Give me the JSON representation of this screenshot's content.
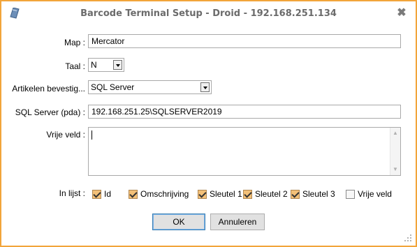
{
  "window": {
    "title": "Barcode Terminal Setup - Droid - 192.168.251.134",
    "accent_color": "#f2a53a",
    "close_glyph": "✖"
  },
  "form": {
    "map_label": "Map :",
    "map_value": "Mercator",
    "taal_label": "Taal :",
    "taal_value": "N",
    "artikelen_label": "Artikelen bevestig...",
    "artikelen_value": "SQL Server",
    "sqlserver_label": "SQL Server (pda) :",
    "sqlserver_value": "192.168.251.25\\SQLSERVER2019",
    "vrije_label": "Vrije veld :",
    "vrije_value": ""
  },
  "in_lijst": {
    "label": "In lijst :",
    "items": [
      {
        "label": "Id",
        "checked": true
      },
      {
        "label": "Omschrijving",
        "checked": true
      },
      {
        "label": "Sleutel 1",
        "checked": true
      },
      {
        "label": "Sleutel 2",
        "checked": true
      },
      {
        "label": "Sleutel 3",
        "checked": true
      },
      {
        "label": "Vrije veld",
        "checked": false
      }
    ]
  },
  "buttons": {
    "ok_label": "OK",
    "cancel_label": "Annuleren"
  }
}
